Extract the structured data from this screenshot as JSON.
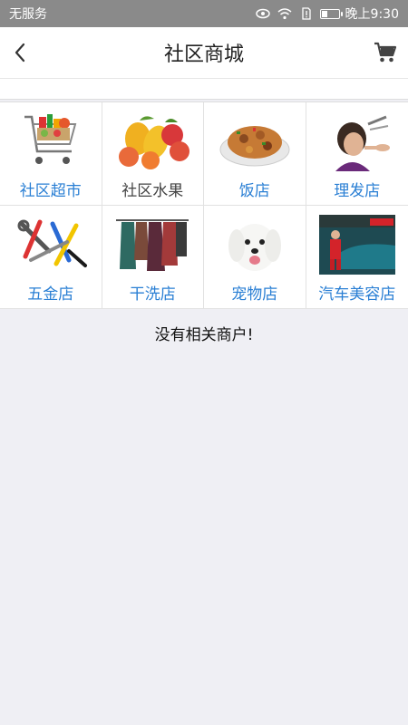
{
  "status_bar": {
    "carrier": "无服务",
    "time": "晚上9:30",
    "battery_level": 0.35
  },
  "header": {
    "title": "社区商城"
  },
  "categories": [
    {
      "label": "社区超市",
      "icon": "shopping-cart-icon",
      "accent": "#2a7fd4"
    },
    {
      "label": "社区水果",
      "icon": "fruit-icon",
      "accent": "#444444"
    },
    {
      "label": "饭店",
      "icon": "food-plate-icon",
      "accent": "#2a7fd4"
    },
    {
      "label": "理发店",
      "icon": "haircut-icon",
      "accent": "#2a7fd4"
    },
    {
      "label": "五金店",
      "icon": "tools-icon",
      "accent": "#2a7fd4"
    },
    {
      "label": "干洗店",
      "icon": "clothes-rack-icon",
      "accent": "#2a7fd4"
    },
    {
      "label": "宠物店",
      "icon": "dog-icon",
      "accent": "#2a7fd4"
    },
    {
      "label": "汽车美容店",
      "icon": "car-wash-icon",
      "accent": "#2a7fd4"
    }
  ],
  "message": {
    "empty": "没有相关商户!"
  }
}
